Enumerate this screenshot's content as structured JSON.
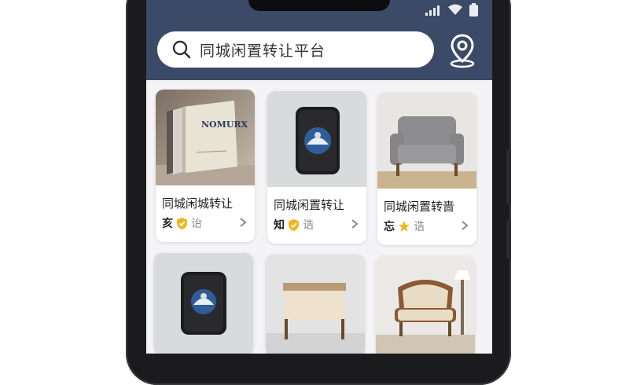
{
  "search": {
    "placeholder": "同城闲置转让平台",
    "icon": "search-icon"
  },
  "location_icon": "location-pin-icon",
  "status_bar": {
    "icons": [
      "signal-icon",
      "wifi-icon",
      "battery-icon"
    ]
  },
  "colors": {
    "header": "#3b4a66",
    "verified_badge": "#f2b51d",
    "star": "#f2b51d"
  },
  "listings": [
    {
      "title": "同城闲城转让",
      "seller": "亥",
      "badge": "shield-check-icon",
      "tag": "诒",
      "image": "books"
    },
    {
      "title": "同城闲置转让",
      "seller": "知",
      "badge": "shield-check-icon",
      "tag": "诰",
      "image": "smart-device"
    },
    {
      "title": "同城闲置转啬",
      "seller": "忘",
      "badge": "star-icon",
      "tag": "诰",
      "image": "armchair-gray"
    },
    {
      "image": "smart-device"
    },
    {
      "image": "cabinet"
    },
    {
      "image": "armchair-vintage"
    }
  ]
}
